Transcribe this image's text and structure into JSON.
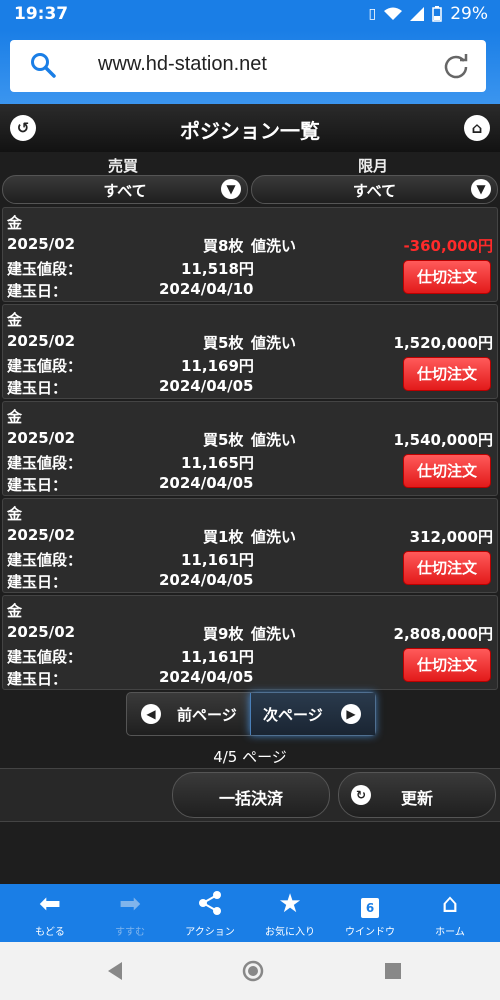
{
  "status_bar": {
    "time": "19:37",
    "battery": "29%"
  },
  "browser": {
    "url": "www.hd-station.net"
  },
  "header": {
    "title": "ポジション一覧"
  },
  "filters": {
    "side_label": "売買",
    "side_value": "すべて",
    "month_label": "限月",
    "month_value": "すべて"
  },
  "positions": [
    {
      "name": "金",
      "month": "2025/02",
      "qty": "買8枚",
      "method": "値洗い",
      "pnl": "-360,000円",
      "price_label": "建玉値段：",
      "price": "11,518円",
      "date_label": "建玉日：",
      "date": "2024/04/10",
      "close_label": "仕切注文"
    },
    {
      "name": "金",
      "month": "2025/02",
      "qty": "買5枚",
      "method": "値洗い",
      "pnl": "1,520,000円",
      "price_label": "建玉値段：",
      "price": "11,169円",
      "date_label": "建玉日：",
      "date": "2024/04/05",
      "close_label": "仕切注文"
    },
    {
      "name": "金",
      "month": "2025/02",
      "qty": "買5枚",
      "method": "値洗い",
      "pnl": "1,540,000円",
      "price_label": "建玉値段：",
      "price": "11,165円",
      "date_label": "建玉日：",
      "date": "2024/04/05",
      "close_label": "仕切注文"
    },
    {
      "name": "金",
      "month": "2025/02",
      "qty": "買1枚",
      "method": "値洗い",
      "pnl": "312,000円",
      "price_label": "建玉値段：",
      "price": "11,161円",
      "date_label": "建玉日：",
      "date": "2024/04/05",
      "close_label": "仕切注文"
    },
    {
      "name": "金",
      "month": "2025/02",
      "qty": "買9枚",
      "method": "値洗い",
      "pnl": "2,808,000円",
      "price_label": "建玉値段：",
      "price": "11,161円",
      "date_label": "建玉日：",
      "date": "2024/04/05",
      "close_label": "仕切注文"
    }
  ],
  "pager": {
    "prev": "前ページ",
    "next": "次ページ",
    "info": "4/5 ページ"
  },
  "actions": {
    "settle_all": "一括決済",
    "refresh": "更新"
  },
  "bottom_nav": {
    "back": "もどる",
    "forward": "すすむ",
    "action": "アクション",
    "favorite": "お気に入り",
    "window": "ウインドウ",
    "window_count": "6",
    "home": "ホーム"
  },
  "colors": {
    "accent": "#1a7ee6",
    "loss": "#ff2a2a",
    "close_button": "#e21a1a"
  }
}
